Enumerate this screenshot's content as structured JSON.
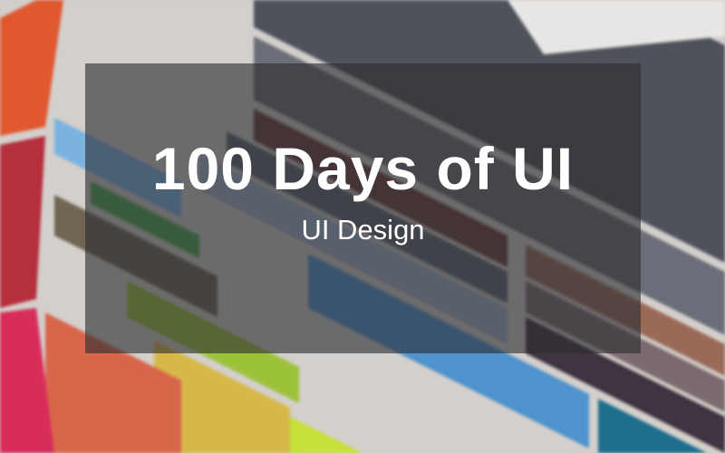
{
  "banner": {
    "title": "100 Days of UI",
    "subtitle": "UI Design"
  },
  "colors": {
    "overlay": "#2d2d32",
    "text": "#ffffff"
  }
}
